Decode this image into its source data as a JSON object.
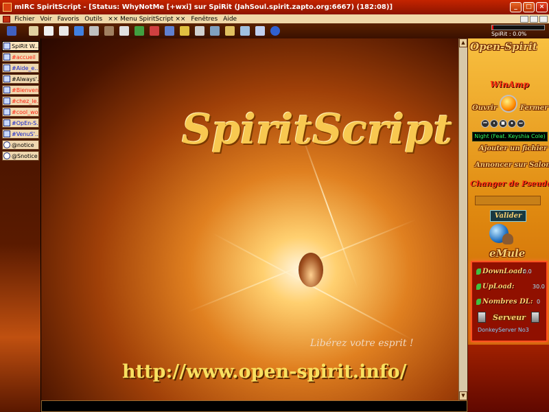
{
  "window": {
    "title": "mIRC SpiritScript - [Status: WhyNotMe [+wxi] sur SpiRit (JahSoul.spirit.zapto.org:6667) (182:08)]",
    "minimize": "_",
    "maximize": "□",
    "close": "×"
  },
  "menu": {
    "items": [
      "Fichier",
      "Voir",
      "Favoris",
      "Outils",
      "×× Menu SpiritScript ××",
      "Fenêtres",
      "Aide"
    ]
  },
  "toolbar": {
    "icons": [
      "connect-icon",
      "options-icon",
      "address-book-icon",
      "scripts-editor-icon",
      "notify-icon",
      "away-icon",
      "font-icon",
      "list-channels-icon",
      "favorites-icon",
      "music-icon",
      "colors-icon",
      "folder-icon",
      "send-file-icon",
      "dcc-chat-icon",
      "help-icon",
      "window-icon",
      "window-alt-icon",
      "info-icon"
    ],
    "meter_label": "SpiRit : 0.0%",
    "meter_fraction": 0.02
  },
  "switchbar": {
    "items": [
      {
        "label": "SpiRit W...",
        "color": "#000000",
        "active": true,
        "kind": "server"
      },
      {
        "label": "#accueil",
        "color": "#ff2010",
        "active": false,
        "kind": "channel"
      },
      {
        "label": "#Aide_e...",
        "color": "#1020d0",
        "active": false,
        "kind": "channel"
      },
      {
        "label": "#Always'...",
        "color": "#000000",
        "active": false,
        "kind": "channel"
      },
      {
        "label": "#Bienven...",
        "color": "#ff2010",
        "active": false,
        "kind": "channel"
      },
      {
        "label": "#chez_le...",
        "color": "#ff2010",
        "active": false,
        "kind": "channel"
      },
      {
        "label": "#cool_wo...",
        "color": "#ff2010",
        "active": false,
        "kind": "channel"
      },
      {
        "label": "#OpEn-S...",
        "color": "#1020d0",
        "active": false,
        "kind": "channel"
      },
      {
        "label": "#VenuS'...",
        "color": "#1020d0",
        "active": false,
        "kind": "channel"
      },
      {
        "label": "@notice",
        "color": "#000000",
        "active": false,
        "kind": "notice"
      },
      {
        "label": "@Snotice",
        "color": "#000000",
        "active": false,
        "kind": "notice"
      }
    ]
  },
  "main": {
    "logo_text": "SpiritScript",
    "slogan": "Libérez votre esprit !",
    "url": "http://www.open-spirit.info/"
  },
  "scrollbar": {
    "up": "▲",
    "down": "▼"
  },
  "panel": {
    "title": "Open-Spirit",
    "winamp": {
      "title": "WinAmp",
      "open_label": "Ouvrir",
      "close_label": "Fermer",
      "controls": [
        "⏮",
        "⏸",
        "■",
        "⏹",
        "⏭"
      ],
      "track": "Night (Feat. Keyshia Cole)"
    },
    "add_file_label": "Ajouter un fichier",
    "announce_label": "Annoncer sur Salon",
    "pseudo_title": "Changer de Pseudo",
    "pseudo_value": "",
    "validate_label": "Valider",
    "emule": {
      "title": "eMule",
      "stats": [
        {
          "label": "DownLoad:",
          "value": "0.0"
        },
        {
          "label": "UpLoad:",
          "value": "30.0"
        },
        {
          "label": "Nombres DL:",
          "value": "0"
        }
      ],
      "server_label": "Serveur",
      "server_name": "DonkeyServer No3"
    }
  },
  "colors": {
    "titlebar": "#c42400",
    "menubar": "#f0d8a8",
    "toolbar": "#4a1800",
    "panel": "#e08a10",
    "accent_gold": "#f8d070"
  }
}
